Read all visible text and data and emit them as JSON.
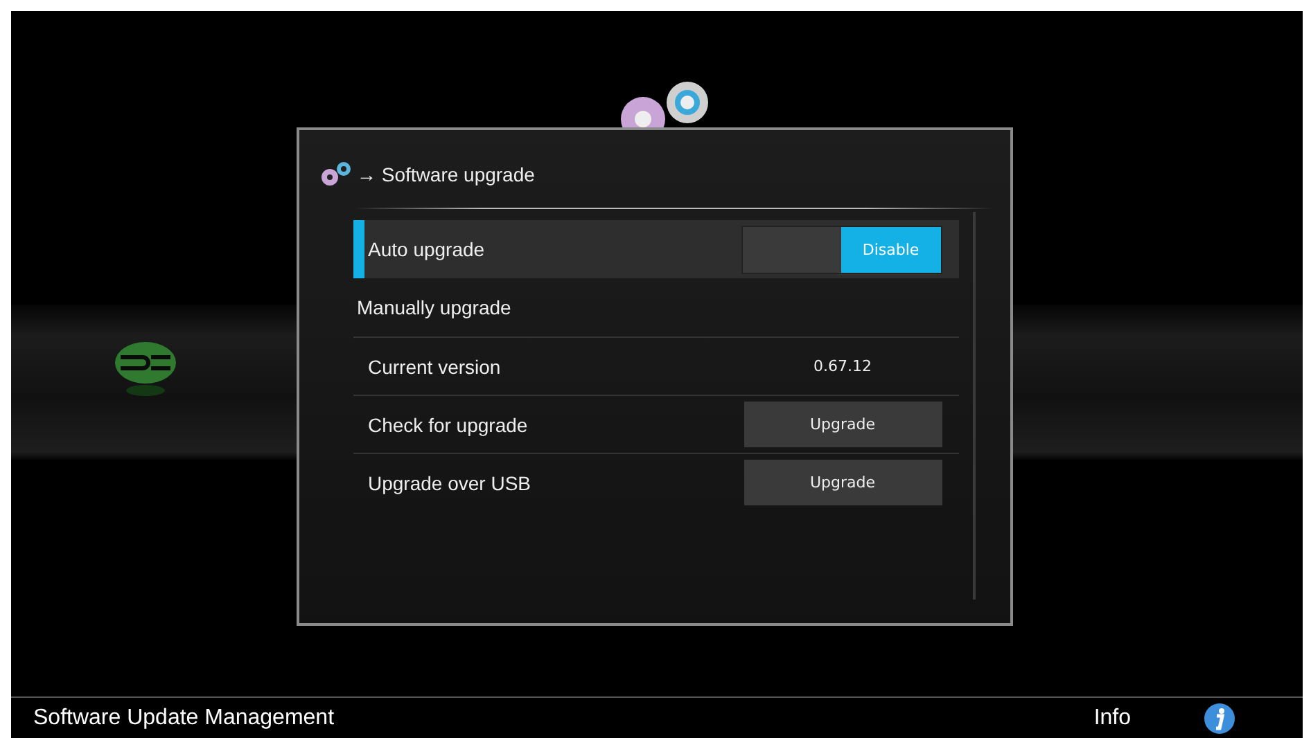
{
  "dialog": {
    "title": "→ Software upgrade",
    "rows": [
      {
        "kind": "toggle",
        "label": "Auto upgrade",
        "selected": true,
        "switch": {
          "label": "Disable",
          "on": true
        }
      },
      {
        "kind": "header",
        "label": "Manually upgrade",
        "selected": false
      },
      {
        "kind": "value",
        "label": "Current version",
        "value": "0.67.12",
        "selected": false
      },
      {
        "kind": "button",
        "label": "Check for upgrade",
        "button": "Upgrade",
        "selected": false
      },
      {
        "kind": "button",
        "label": "Upgrade over USB",
        "button": "Upgrade",
        "selected": false
      }
    ]
  },
  "status_bar": {
    "title": "Software Update Management",
    "info": "Info"
  }
}
